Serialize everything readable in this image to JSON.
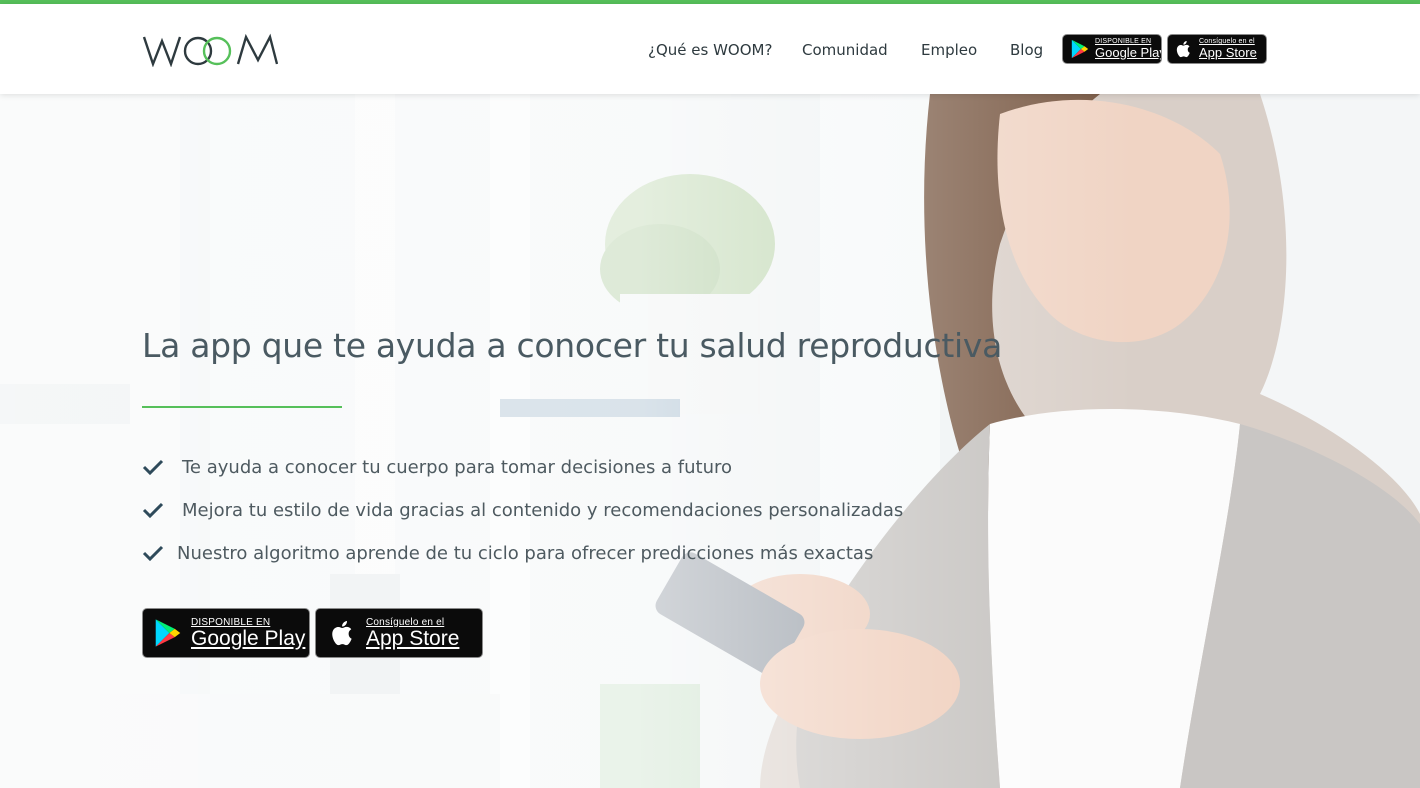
{
  "brand": {
    "logo_text": "WOOM",
    "accent": "#56c05a",
    "dark": "#2e3a3f"
  },
  "nav": {
    "items": [
      {
        "label": "¿Qué es WOOM?"
      },
      {
        "label": "Comunidad"
      },
      {
        "label": "Empleo"
      },
      {
        "label": "Blog"
      }
    ]
  },
  "badges": {
    "google_small": "DISPONIBLE EN",
    "google_big": "Google Play",
    "apple_small": "Consíguelo en el",
    "apple_big": "App Store"
  },
  "hero": {
    "headline": "La app que te ayuda a conocer tu salud reproductiva",
    "features": [
      "Te ayuda a conocer tu cuerpo para tomar decisiones a futuro",
      "Mejora tu estilo de vida gracias al contenido y recomendaciones personalizadas",
      "Nuestro algoritmo aprende de tu ciclo para ofrecer predicciones más exactas"
    ]
  },
  "icons": [
    "check-icon",
    "google-play-icon",
    "apple-icon"
  ]
}
